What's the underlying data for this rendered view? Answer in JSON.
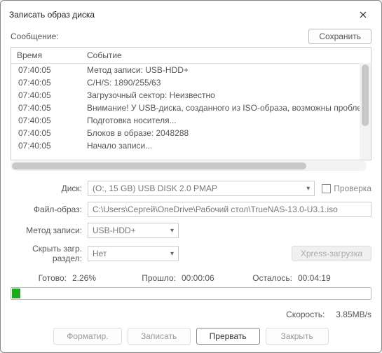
{
  "window": {
    "title": "Записать образ диска"
  },
  "message": {
    "label": "Сообщение:",
    "save": "Сохранить"
  },
  "log": {
    "headers": {
      "time": "Время",
      "event": "Событие"
    },
    "rows": [
      {
        "t": "07:40:05",
        "e": "Метод записи: USB-HDD+"
      },
      {
        "t": "07:40:05",
        "e": "C/H/S: 1890/255/63"
      },
      {
        "t": "07:40:05",
        "e": "Загрузочный сектор: Неизвестно"
      },
      {
        "t": "07:40:05",
        "e": "Внимание! У USB-диска, созданного из ISO-образа, возможны проблемы"
      },
      {
        "t": "07:40:05",
        "e": "Подготовка носителя..."
      },
      {
        "t": "07:40:05",
        "e": "Блоков в образе: 2048288"
      },
      {
        "t": "07:40:05",
        "e": "Начало записи..."
      }
    ]
  },
  "form": {
    "disk_label": "Диск:",
    "disk_value": "(O:, 15 GB)      USB DISK 2.0    PMAP",
    "check_label": "Проверка",
    "file_label": "Файл-образ:",
    "file_value": "C:\\Users\\Сергей\\OneDrive\\Рабочий стол\\TrueNAS-13.0-U3.1.iso",
    "method_label": "Метод записи:",
    "method_value": "USB-HDD+",
    "hide_label": "Скрыть загр. раздел:",
    "hide_value": "Нет",
    "xpress": "Xpress-загрузка"
  },
  "progress": {
    "ready_label": "Готово:",
    "ready_value": "2.26%",
    "elapsed_label": "Прошло:",
    "elapsed_value": "00:00:06",
    "remain_label": "Осталось:",
    "remain_value": "00:04:19",
    "percent": 2.26
  },
  "speed": {
    "label": "Скорость:",
    "value": "3.85MB/s"
  },
  "buttons": {
    "format": "Форматир.",
    "write": "Записать",
    "abort": "Прервать",
    "close": "Закрыть"
  }
}
